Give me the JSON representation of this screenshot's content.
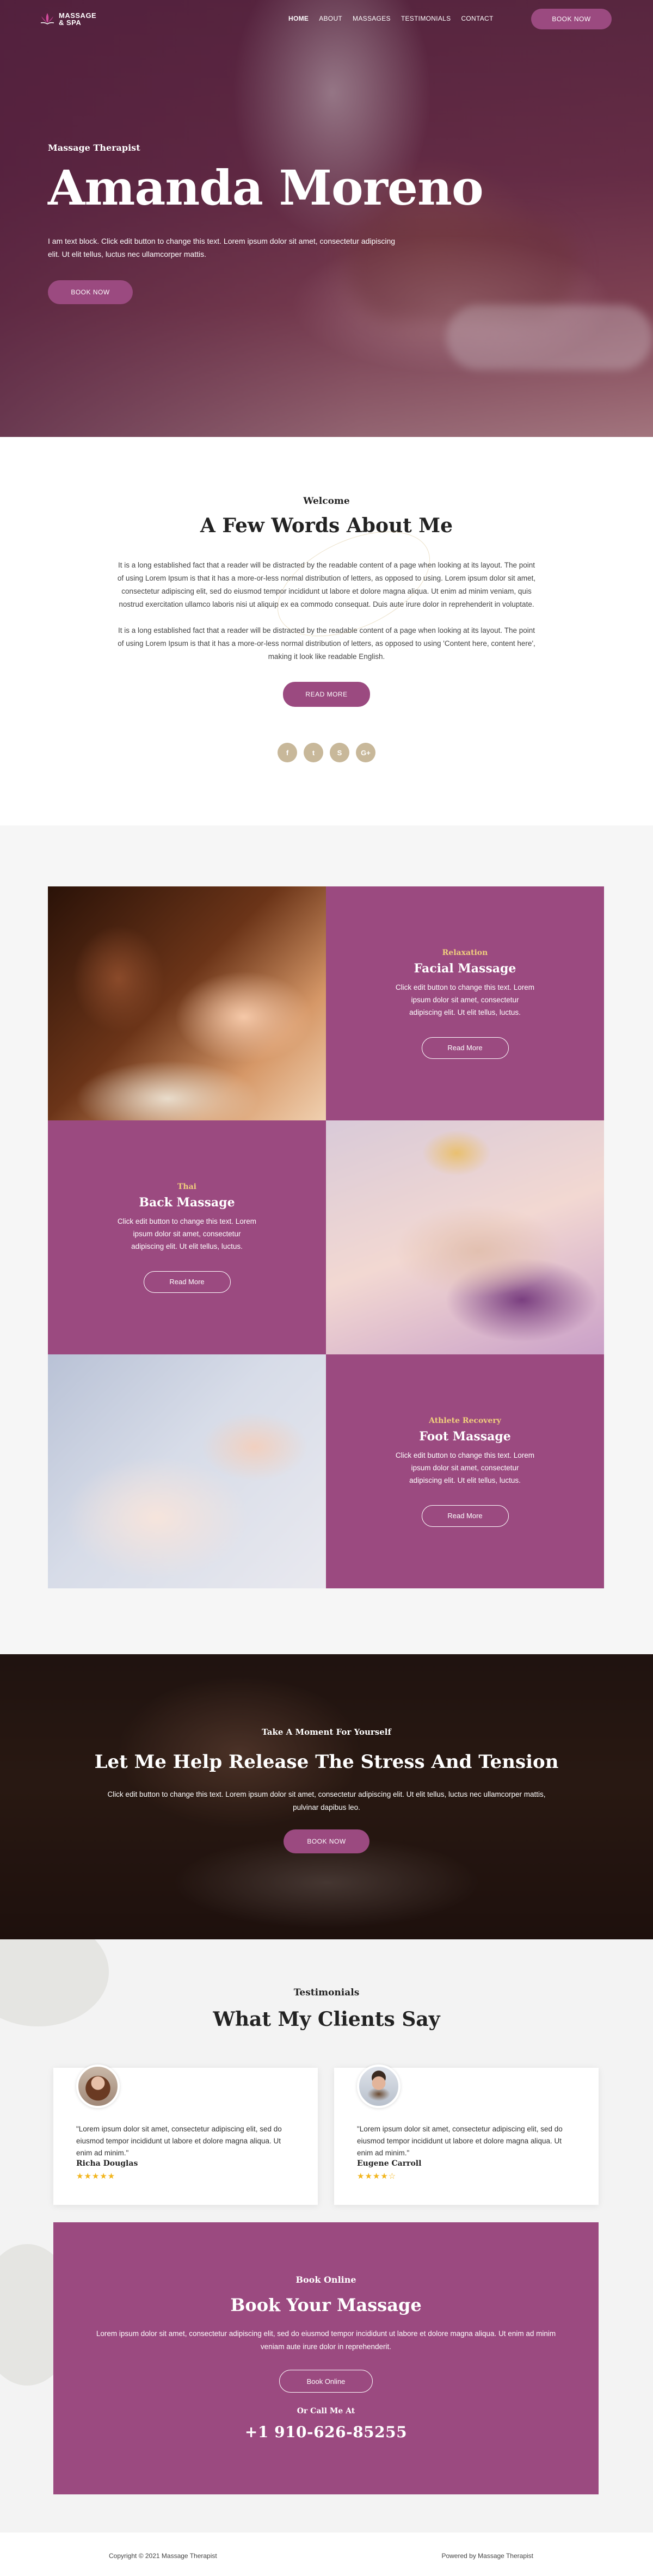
{
  "nav": {
    "logo_line1": "MASSAGE",
    "logo_line2": "& SPA",
    "items": [
      {
        "label": "HOME",
        "active": true
      },
      {
        "label": "ABOUT"
      },
      {
        "label": "MASSAGES"
      },
      {
        "label": "TESTIMONIALS"
      },
      {
        "label": "CONTACT"
      }
    ],
    "book_label": "BOOK NOW"
  },
  "hero": {
    "subtitle": "Massage Therapist",
    "title": "Amanda Moreno",
    "text": "I am text block. Click edit button to change this text. Lorem ipsum dolor sit amet, consectetur adipiscing elit. Ut elit tellus, luctus nec ullamcorper mattis.",
    "button": "BOOK NOW"
  },
  "about": {
    "label": "Welcome",
    "title": "A Few Words About Me",
    "p1": "It is a long established fact that a reader will be distracted by the readable content of a page when looking at its layout. The point of using Lorem Ipsum is that it has a more-or-less normal distribution of letters, as opposed to using. Lorem ipsum dolor sit amet, consectetur adipiscing elit, sed do eiusmod tempor incididunt ut labore et dolore magna aliqua. Ut enim ad minim veniam, quis nostrud exercitation ullamco laboris nisi ut aliquip ex ea commodo consequat. Duis aute irure dolor in reprehenderit in voluptate.",
    "p2": "It is a long established fact that a reader will be distracted by the readable content of a page when looking at its layout. The point of using Lorem Ipsum is that it has a more-or-less normal distribution of letters, as opposed to using 'Content here, content here', making it look like readable English.",
    "button": "READ MORE",
    "socials": [
      {
        "icon": "facebook-icon",
        "glyph": "f"
      },
      {
        "icon": "twitter-icon",
        "glyph": "t"
      },
      {
        "icon": "skype-icon",
        "glyph": "S"
      },
      {
        "icon": "google-plus-icon",
        "glyph": "G+"
      }
    ]
  },
  "services": [
    {
      "category": "Relaxation",
      "title": "Facial Massage",
      "text": "Click edit button to change this text. Lorem ipsum dolor sit amet, consectetur adipiscing elit. Ut elit tellus, luctus.",
      "button": "Read More"
    },
    {
      "category": "Thai",
      "title": "Back Massage",
      "text": "Click edit button to change this text. Lorem ipsum dolor sit amet, consectetur adipiscing elit. Ut elit tellus, luctus.",
      "button": "Read More"
    },
    {
      "category": "Athlete Recovery",
      "title": "Foot Massage",
      "text": "Click edit button to change this text. Lorem ipsum dolor sit amet, consectetur adipiscing elit. Ut elit tellus, luctus.",
      "button": "Read More"
    }
  ],
  "banner": {
    "subtitle": "Take A Moment For Yourself",
    "title": "Let Me Help Release The Stress And Tension",
    "text": "Click edit button to change this text. Lorem ipsum dolor sit amet, consectetur adipiscing elit. Ut elit tellus, luctus nec ullamcorper mattis, pulvinar dapibus leo.",
    "button": "BOOK NOW"
  },
  "testimonials": {
    "label": "Testimonials",
    "title": "What My Clients Say",
    "items": [
      {
        "quote": "\"Lorem ipsum dolor sit amet, consectetur adipiscing elit, sed do eiusmod tempor incididunt ut labore et dolore magna aliqua. Ut enim ad minim.\"",
        "author": "Richa Douglas",
        "rating": 5,
        "stars": "★★★★★"
      },
      {
        "quote": "\"Lorem ipsum dolor sit amet, consectetur adipiscing elit, sed do eiusmod tempor incididunt ut labore et dolore magna aliqua. Ut enim ad minim.\"",
        "author": "Eugene Carroll",
        "rating": 4,
        "stars": "★★★★☆"
      }
    ]
  },
  "booking": {
    "subtitle": "Book Online",
    "title": "Book Your Massage",
    "text": "Lorem ipsum dolor sit amet, consectetur adipiscing elit, sed do eiusmod tempor incididunt ut labore et dolore magna aliqua. Ut enim ad minim veniam aute irure dolor in reprehenderit.",
    "button": "Book Online",
    "call_label": "Or Call Me At",
    "phone": "+1 910-626-85255"
  },
  "footer": {
    "copyright": "Copyright © 2021 Massage Therapist",
    "powered": "Powered by Massage Therapist"
  },
  "colors": {
    "brand": "#9b4a80",
    "accent_gold": "#f0cf7d",
    "star": "#f2b51c"
  }
}
